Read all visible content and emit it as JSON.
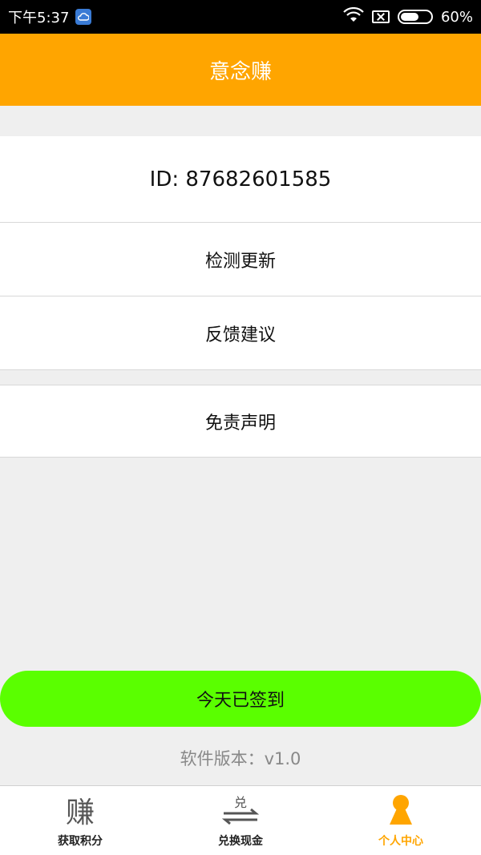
{
  "status_bar": {
    "time": "下午5:37",
    "battery": "60%",
    "battery_level": 0.6
  },
  "header": {
    "title": "意念赚"
  },
  "user": {
    "id_text": "ID: 87682601585"
  },
  "menu": {
    "check_update": "检测更新",
    "feedback": "反馈建议",
    "disclaimer": "免责声明"
  },
  "signin": {
    "label": "今天已签到"
  },
  "version": {
    "text": "软件版本：v1.0"
  },
  "bottom_nav": {
    "earn": {
      "label": "获取积分",
      "icon_char": "赚"
    },
    "exchange": {
      "label": "兑换现金",
      "icon_char": "兑"
    },
    "profile": {
      "label": "个人中心"
    }
  },
  "colors": {
    "accent": "#ffa500",
    "signin_green": "#5aff00"
  }
}
